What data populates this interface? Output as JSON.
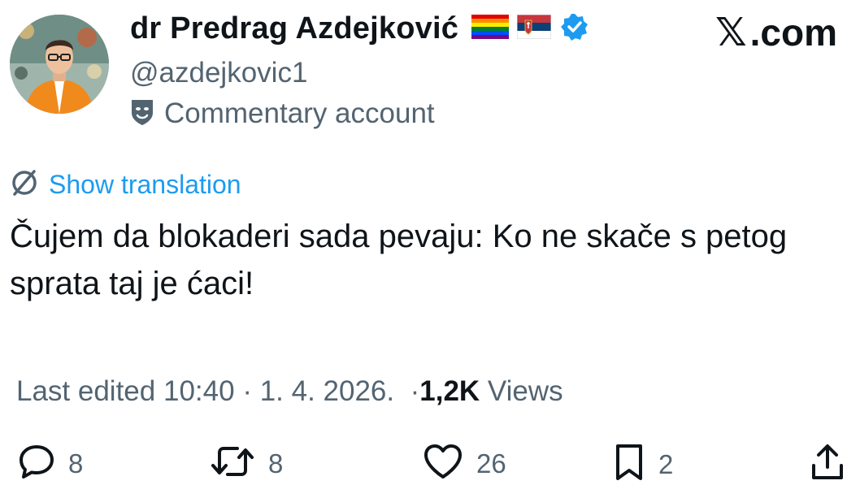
{
  "profile": {
    "display_name": "dr Predrag Azdejković",
    "handle": "@azdejkovic1",
    "commentary_label": "Commentary account",
    "flags": [
      "rainbow-flag-icon",
      "serbia-flag-icon"
    ],
    "verified_icon": "verified-badge-icon"
  },
  "brand": {
    "x": "𝕏",
    "text": ".com"
  },
  "translation": {
    "label": "Show translation",
    "icon": "translate-icon"
  },
  "tweet": {
    "text": "Čujem da blokaderi sada pevaju: Ko ne skače s petog sprata taj je ćaci!"
  },
  "meta": {
    "edited_label": "Last edited",
    "time": "10:40",
    "date": "1. 4. 2026.",
    "views_count": "1,2K",
    "views_label": "Views"
  },
  "actions": {
    "replies": "8",
    "retweets": "8",
    "likes": "26",
    "bookmarks": "2"
  },
  "colors": {
    "accent": "#1d9bf0",
    "secondary_text": "#536471",
    "primary_text": "#0f1419"
  }
}
